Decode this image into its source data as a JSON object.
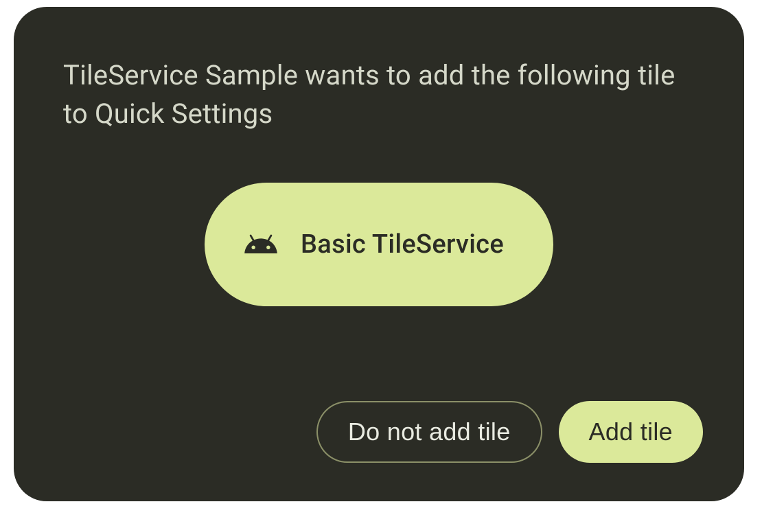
{
  "dialog": {
    "message": "TileService Sample wants to add the following tile to Quick Settings"
  },
  "tile": {
    "label": "Basic TileService",
    "icon_name": "android-icon"
  },
  "buttons": {
    "cancel_label": "Do not add tile",
    "confirm_label": "Add tile"
  },
  "colors": {
    "dialog_bg": "#2b2c25",
    "accent": "#dbe99a",
    "text_muted": "#d5d8c9",
    "outline": "#8b9068"
  }
}
